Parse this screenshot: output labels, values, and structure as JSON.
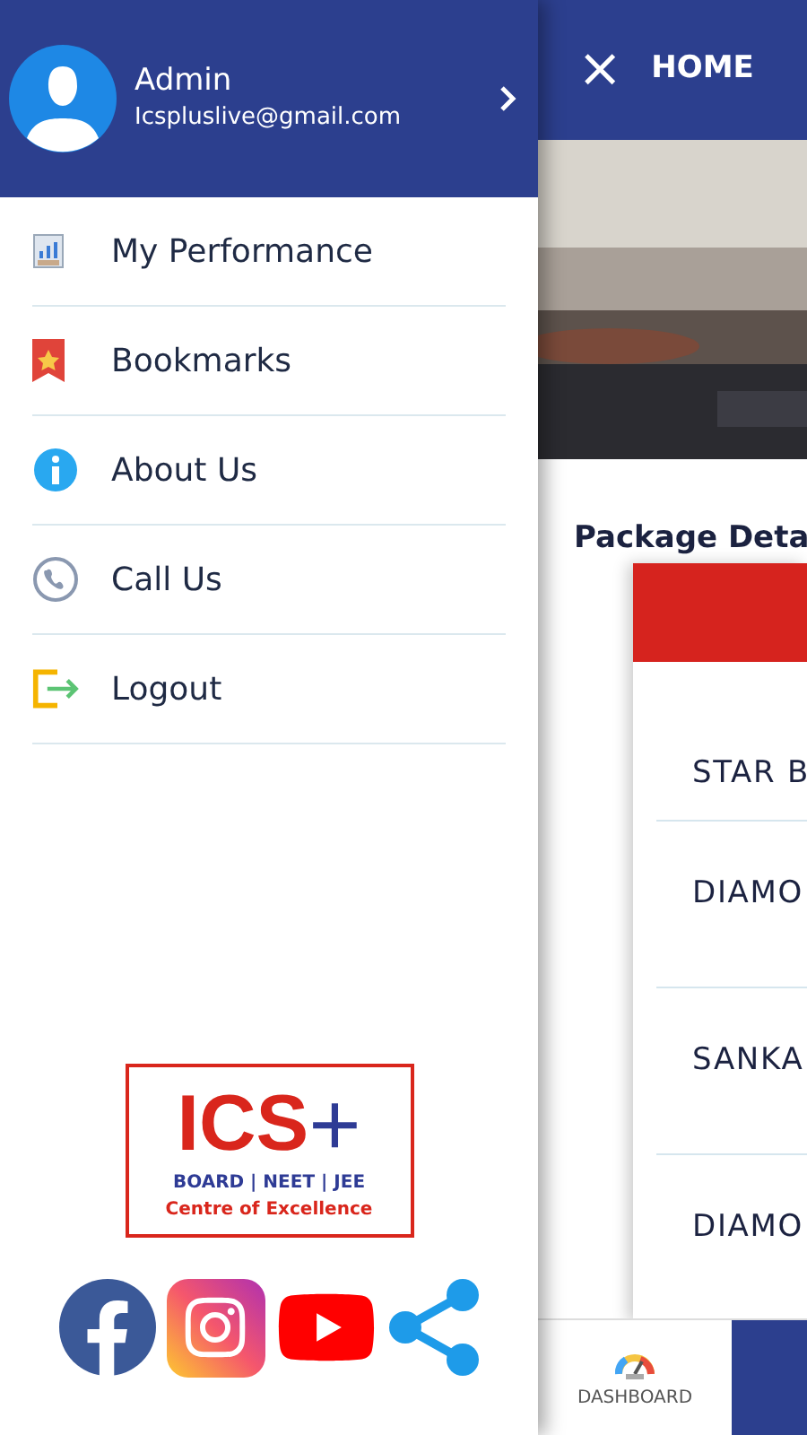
{
  "drawer": {
    "user": {
      "name": "Admin",
      "email": "Icspluslive@gmail.com"
    },
    "menu": [
      {
        "label": "My Performance"
      },
      {
        "label": "Bookmarks"
      },
      {
        "label": "About Us"
      },
      {
        "label": "Call Us"
      },
      {
        "label": "Logout"
      }
    ],
    "logo": {
      "title": "ICS",
      "plus": "+",
      "subtitle": "BOARD | NEET | JEE",
      "tagline": "Centre of Excellence"
    }
  },
  "app": {
    "title": "HOME",
    "close": "×",
    "section_title": "Package Deta",
    "packages": [
      "STAR B",
      "DIAMO",
      "SANKA",
      "DIAMO"
    ],
    "bottom_nav": [
      {
        "label": "DASHBOARD",
        "selected": false
      },
      {
        "selected": true
      }
    ]
  }
}
